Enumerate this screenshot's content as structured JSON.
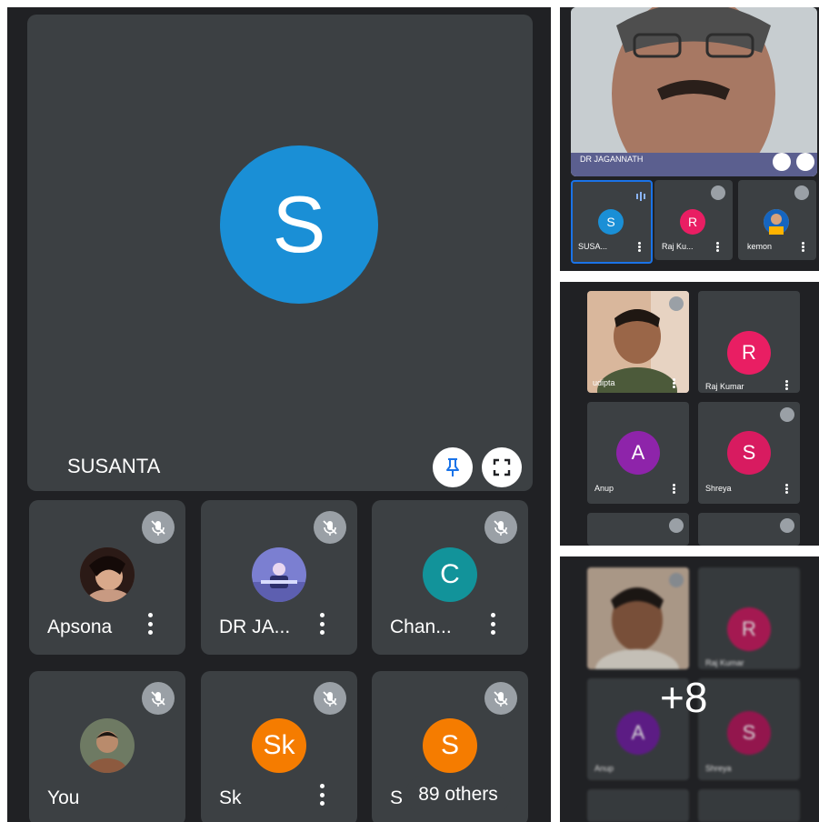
{
  "main": {
    "featured": {
      "initial": "S",
      "name": "SUSANTA",
      "avatar_color": "#1a8fd6"
    },
    "tiles": [
      {
        "name": "Apsona",
        "type": "photo"
      },
      {
        "name": "DR JA...",
        "type": "photo"
      },
      {
        "name": "Chan...",
        "initial": "C",
        "color": "#12939a"
      },
      {
        "name": "You",
        "type": "photo"
      },
      {
        "name": "Sk",
        "initial": "Sk",
        "color": "#f57c00"
      },
      {
        "name": "S",
        "initial": "S",
        "color": "#f57c00"
      }
    ],
    "others_label": "89 others"
  },
  "thumb1": {
    "speaker_name": "DR JAGANNATH",
    "strip": [
      {
        "initial": "S",
        "name": "SUSA...",
        "color": "#1a8fd6"
      },
      {
        "initial": "R",
        "name": "Raj Ku...",
        "color": "#e91e63"
      },
      {
        "name": "kemon",
        "type": "photo"
      }
    ]
  },
  "thumb2": {
    "tiles": [
      {
        "name": "udipta",
        "type": "photo"
      },
      {
        "initial": "R",
        "name": "Raj Kumar",
        "color": "#e91e63"
      },
      {
        "initial": "A",
        "name": "Anup",
        "color": "#8e24aa"
      },
      {
        "initial": "S",
        "name": "Shreya",
        "color": "#d81b60"
      }
    ]
  },
  "thumb3": {
    "tiles": [
      {
        "name": "",
        "type": "photo"
      },
      {
        "initial": "R",
        "name": "Raj Kumar",
        "color": "#c2185b"
      },
      {
        "initial": "A",
        "name": "Anup",
        "color": "#6a1b9a"
      },
      {
        "initial": "S",
        "name": "Shreya",
        "color": "#ad1457"
      }
    ],
    "more_label": "+8"
  }
}
